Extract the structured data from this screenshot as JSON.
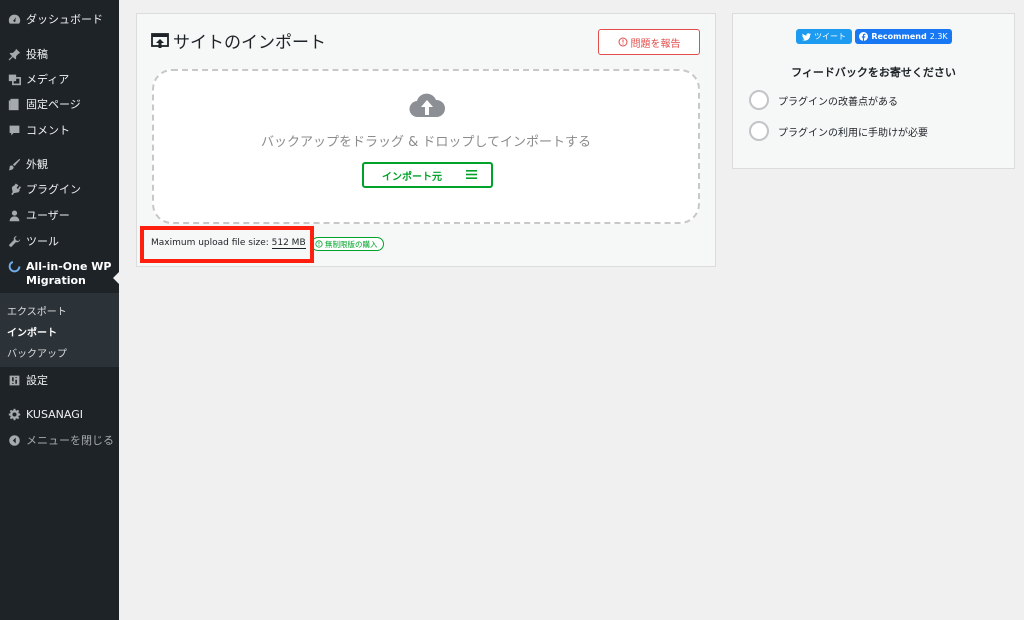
{
  "sidebar": {
    "items": [
      {
        "label": "ダッシュボード",
        "icon": "dashboard-icon"
      },
      {
        "label": "投稿",
        "icon": "pin-icon"
      },
      {
        "label": "メディア",
        "icon": "media-icon"
      },
      {
        "label": "固定ページ",
        "icon": "page-icon"
      },
      {
        "label": "コメント",
        "icon": "comment-icon"
      },
      {
        "label": "外観",
        "icon": "brush-icon"
      },
      {
        "label": "プラグイン",
        "icon": "plugin-icon"
      },
      {
        "label": "ユーザー",
        "icon": "user-icon"
      },
      {
        "label": "ツール",
        "icon": "wrench-icon"
      }
    ],
    "active": {
      "label_line1": "All-in-One WP",
      "label_line2": "Migration",
      "icon": "migration-icon"
    },
    "submenu": [
      "エクスポート",
      "インポート",
      "バックアップ"
    ],
    "after": [
      {
        "label": "設定",
        "icon": "settings-icon"
      },
      {
        "label": "KUSANAGI",
        "icon": "gear-icon"
      },
      {
        "label": "メニューを閉じる",
        "icon": "collapse-icon"
      }
    ]
  },
  "main": {
    "title": "サイトのインポート",
    "report_button": "問題を報告",
    "drop_text": "バックアップをドラッグ & ドロップしてインポートする",
    "import_button": "インポート元",
    "upload_label": "Maximum upload file size: ",
    "upload_size": "512 MB",
    "upgrade_badge": "無制限版の購入"
  },
  "right": {
    "tweet_button": "ツイート",
    "fb_button": "Recommend",
    "fb_count": "2.3K",
    "feedback_title": "フィードバックをお寄せください",
    "options": [
      "プラグインの改善点がある",
      "プラグインの利用に手助けが必要"
    ]
  },
  "colors": {
    "sidebar_bg": "#1d2327",
    "submenu_bg": "#2c3338",
    "report_red": "#e24c4b",
    "import_green": "#00a32a",
    "highlight_red": "#ff1f0f",
    "twitter_blue": "#1d9bf0",
    "facebook_blue": "#1877f2"
  }
}
